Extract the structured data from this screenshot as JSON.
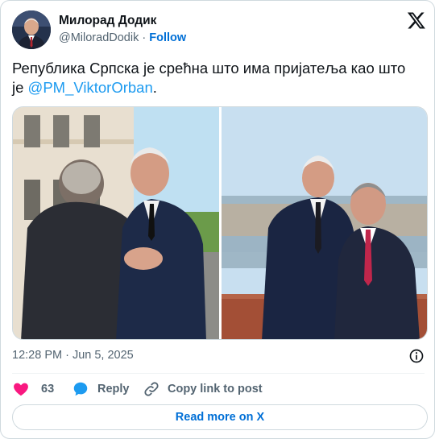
{
  "author": {
    "name": "Милорад Додик",
    "handle": "@MiloradDodik",
    "separator": " · ",
    "follow_label": "Follow"
  },
  "tweet": {
    "text_before": "Република Српска је срећна што има пријатеља као што је ",
    "mention": "@PM_ViktorOrban",
    "text_after": "."
  },
  "media": {
    "photos": [
      {
        "alt": "Photo 1"
      },
      {
        "alt": "Photo 2"
      }
    ]
  },
  "meta": {
    "timestamp": "12:28 PM · Jun 5, 2025"
  },
  "actions": {
    "like_count": "63",
    "reply_label": "Reply",
    "copy_label": "Copy link to post"
  },
  "footer": {
    "read_more_label": "Read more on X"
  },
  "colors": {
    "accent": "#1d9bf0",
    "follow": "#006fd6",
    "like": "#f91880",
    "muted": "#536471",
    "border": "#cfd9de"
  },
  "icons": [
    "x-logo-icon",
    "info-icon",
    "heart-icon",
    "reply-bubble-icon",
    "link-icon"
  ]
}
